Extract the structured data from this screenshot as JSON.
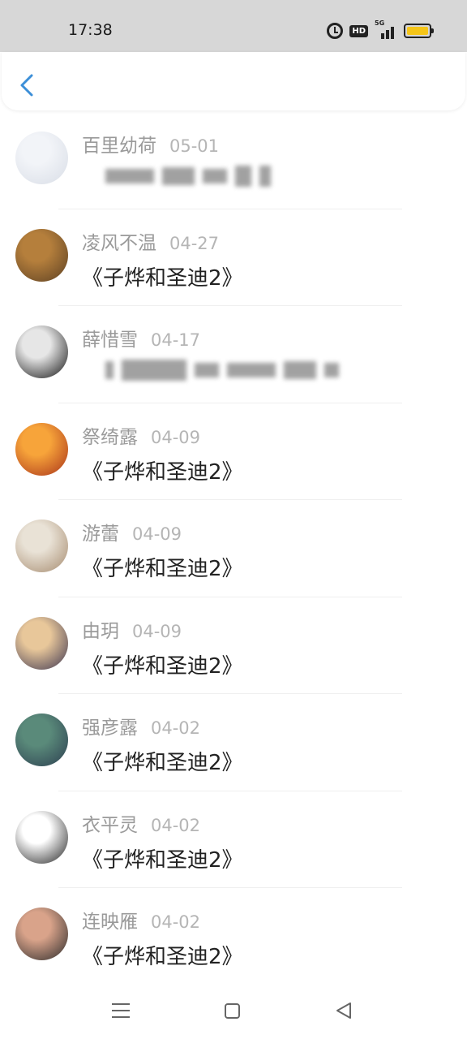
{
  "status_bar": {
    "time": "17:38",
    "hd": "HD",
    "network": "5G"
  },
  "comments": [
    {
      "name": "百里幼荷",
      "date": "05-01",
      "message": "",
      "blurred": true,
      "avatar_colors": [
        "#f2f4f8",
        "#d8dde6"
      ]
    },
    {
      "name": "凌风不温",
      "date": "04-27",
      "message": "《子烨和圣迪2》",
      "blurred": false,
      "avatar_colors": [
        "#b57f3c",
        "#5c4023"
      ]
    },
    {
      "name": "薛惜雪",
      "date": "04-17",
      "message": "",
      "blurred": true,
      "avatar_colors": [
        "#e6e6e6",
        "#111111"
      ]
    },
    {
      "name": "祭绮露",
      "date": "04-09",
      "message": "《子烨和圣迪2》",
      "blurred": false,
      "avatar_colors": [
        "#f7a43a",
        "#a8321a"
      ]
    },
    {
      "name": "游蕾",
      "date": "04-09",
      "message": "《子烨和圣迪2》",
      "blurred": false,
      "avatar_colors": [
        "#e9e2d6",
        "#a58a6e"
      ]
    },
    {
      "name": "由玥",
      "date": "04-09",
      "message": "《子烨和圣迪2》",
      "blurred": false,
      "avatar_colors": [
        "#e8c79a",
        "#3c3550"
      ]
    },
    {
      "name": "强彦露",
      "date": "04-02",
      "message": "《子烨和圣迪2》",
      "blurred": false,
      "avatar_colors": [
        "#5a8a7a",
        "#2c3e50"
      ]
    },
    {
      "name": "衣平灵",
      "date": "04-02",
      "message": "《子烨和圣迪2》",
      "blurred": false,
      "avatar_colors": [
        "#ffffff",
        "#222222"
      ]
    },
    {
      "name": "连映雁",
      "date": "04-02",
      "message": "《子烨和圣迪2》",
      "blurred": false,
      "avatar_colors": [
        "#d9a38a",
        "#2a2a2a"
      ]
    }
  ]
}
